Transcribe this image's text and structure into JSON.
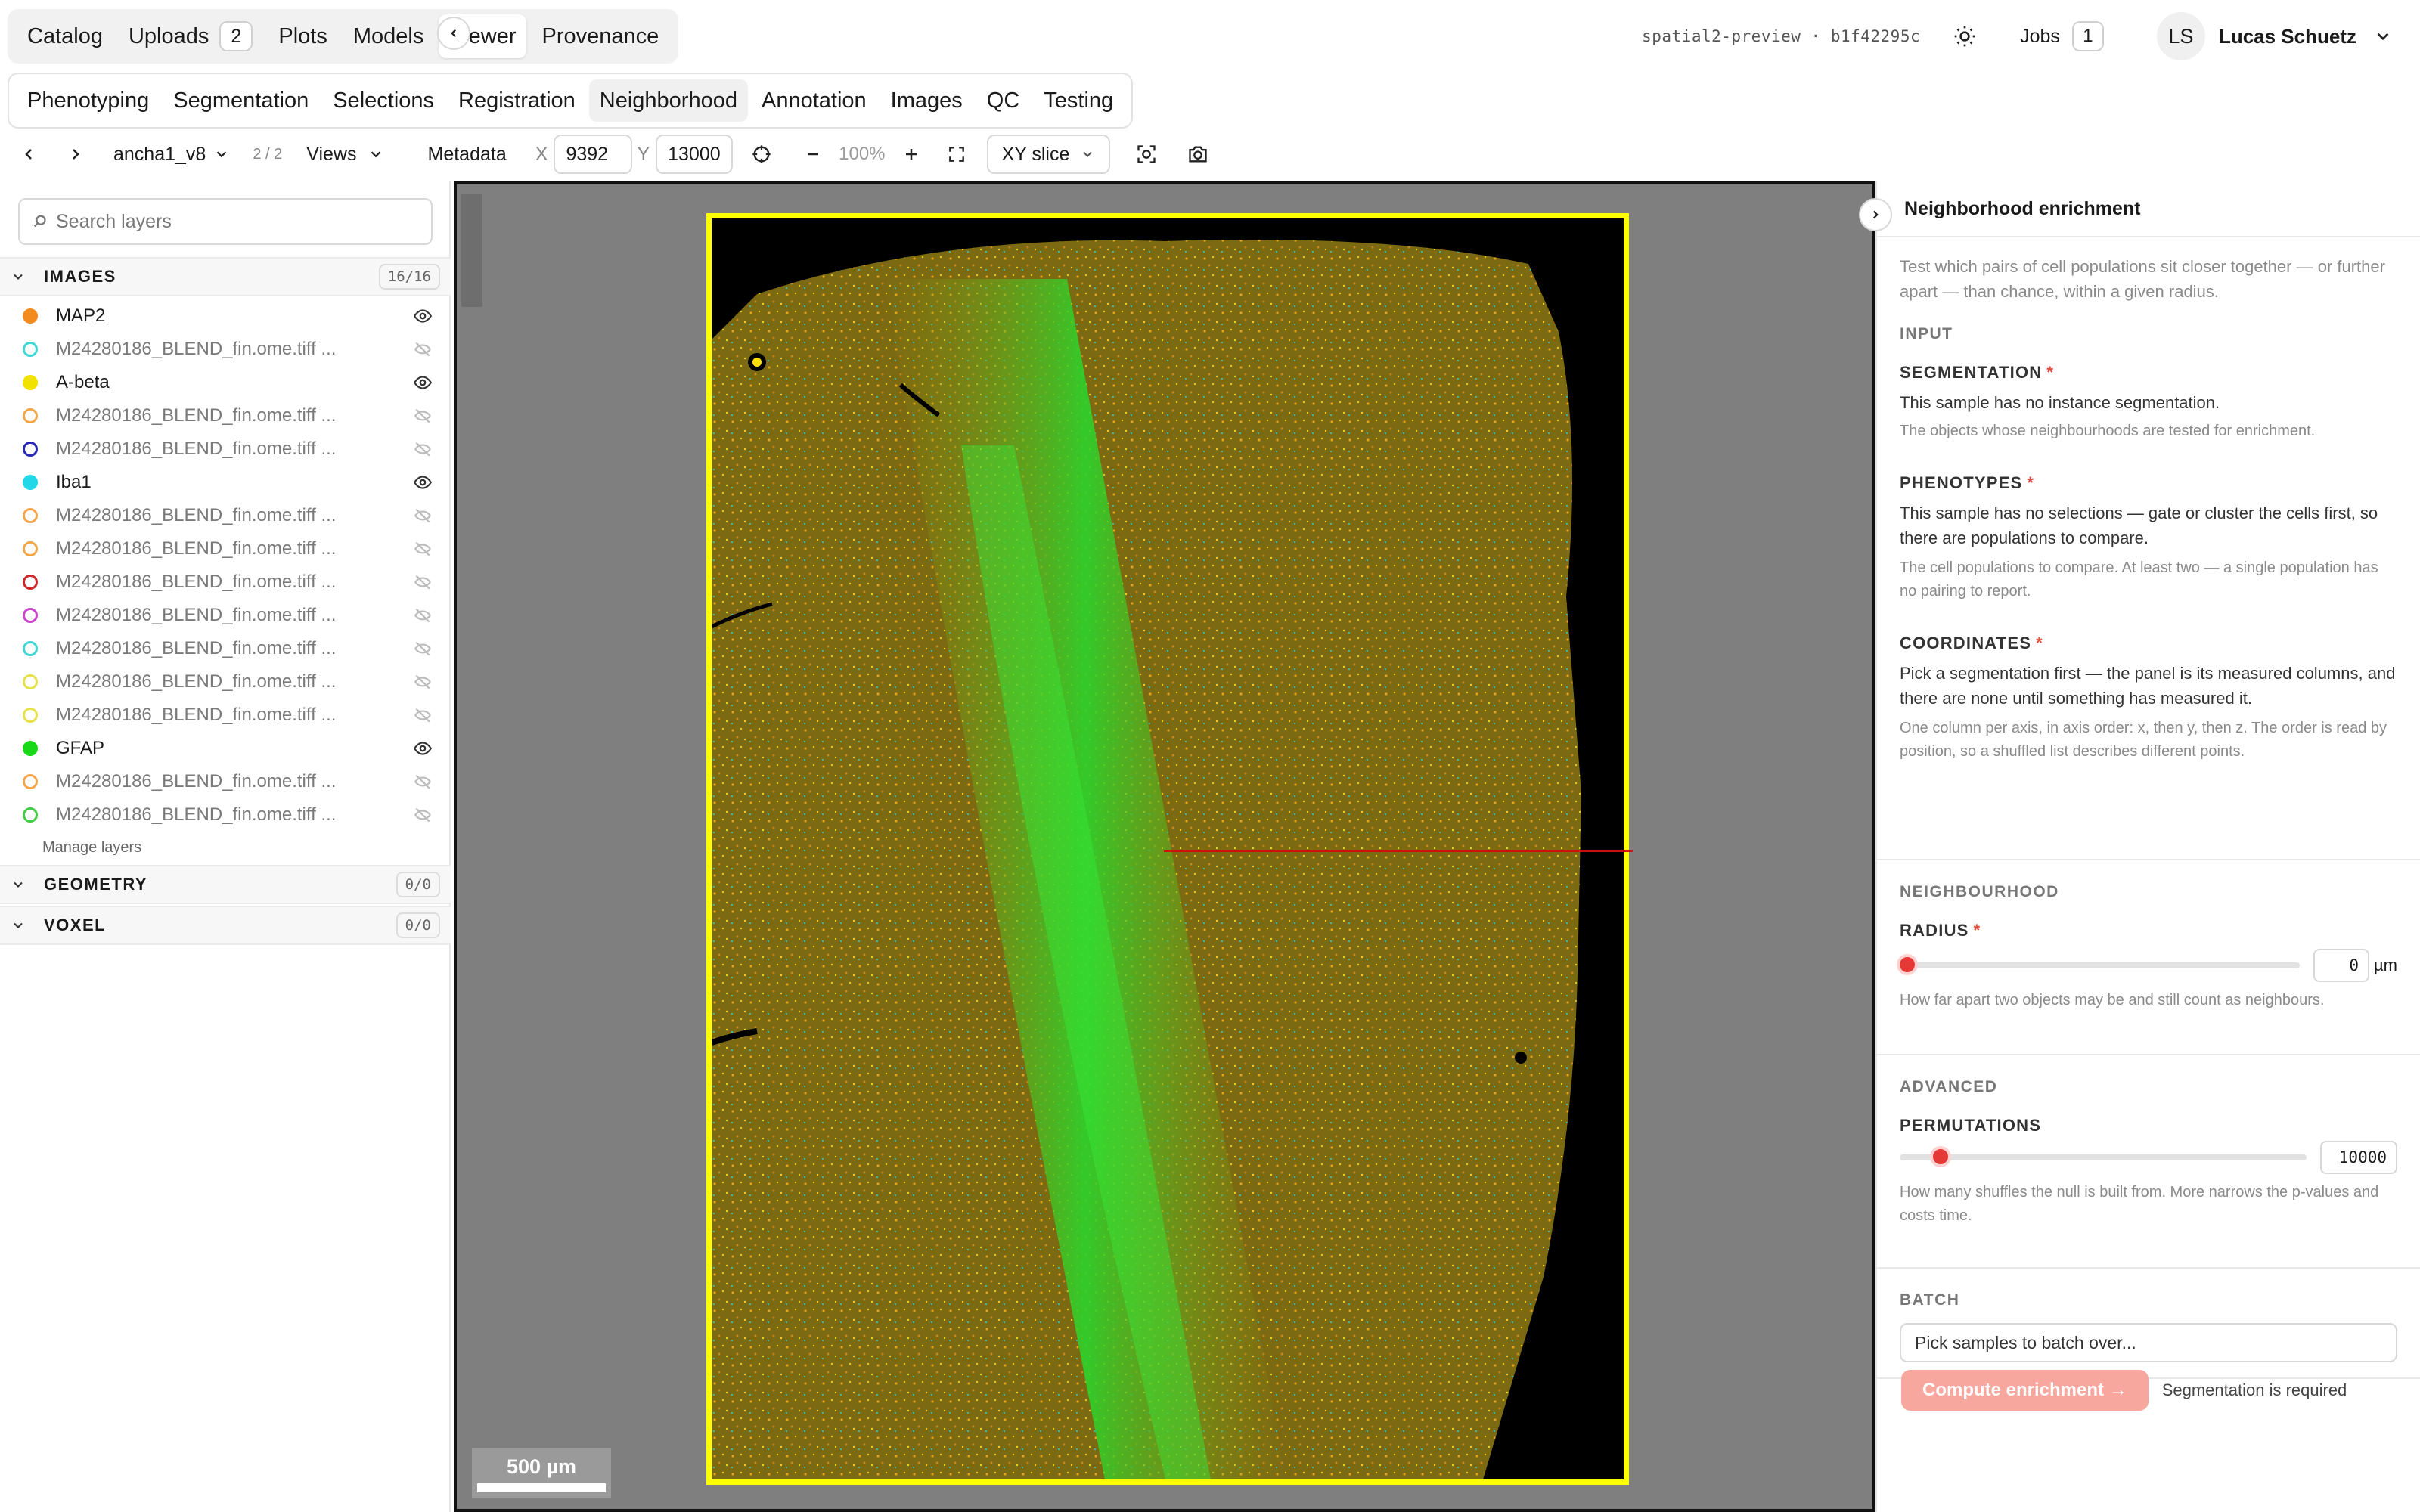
{
  "topnav": {
    "items": [
      {
        "label": "Catalog"
      },
      {
        "label": "Uploads",
        "badge": "2"
      },
      {
        "label": "Plots"
      },
      {
        "label": "Models"
      },
      {
        "label": "Viewer",
        "active": true
      },
      {
        "label": "Provenance"
      }
    ]
  },
  "header": {
    "build_tag": "spatial2-preview · b1f42295c",
    "jobs_label": "Jobs",
    "jobs_count": "1",
    "avatar_initials": "LS",
    "user_name": "Lucas Schuetz"
  },
  "subnav": {
    "items": [
      {
        "label": "Phenotyping"
      },
      {
        "label": "Segmentation"
      },
      {
        "label": "Selections"
      },
      {
        "label": "Registration"
      },
      {
        "label": "Neighborhood",
        "active": true
      },
      {
        "label": "Annotation"
      },
      {
        "label": "Images"
      },
      {
        "label": "QC"
      },
      {
        "label": "Testing"
      }
    ]
  },
  "toolbar": {
    "sample_name": "ancha1_v8",
    "sample_position": "2 / 2",
    "views_label": "Views",
    "metadata_label": "Metadata",
    "x_label": "X",
    "x_value": "9392",
    "y_label": "Y",
    "y_value": "13000",
    "zoom_value": "100%",
    "slice_mode": "XY slice"
  },
  "layers": {
    "search_placeholder": "Search layers",
    "images_header": "IMAGES",
    "images_count": "16/16",
    "items": [
      {
        "name": "MAP2",
        "color": "#f28a1e",
        "filled": true,
        "visible": true
      },
      {
        "name": "M24280186_BLEND_fin.ome.tiff ...",
        "color": "#3fd6d6",
        "filled": false,
        "visible": false
      },
      {
        "name": "A-beta",
        "color": "#f2e200",
        "filled": true,
        "visible": true
      },
      {
        "name": "M24280186_BLEND_fin.ome.tiff ...",
        "color": "#f2a84a",
        "filled": false,
        "visible": false
      },
      {
        "name": "M24280186_BLEND_fin.ome.tiff ...",
        "color": "#2a2ab8",
        "filled": false,
        "visible": false
      },
      {
        "name": "Iba1",
        "color": "#22d8e8",
        "filled": true,
        "visible": true
      },
      {
        "name": "M24280186_BLEND_fin.ome.tiff ...",
        "color": "#f2a84a",
        "filled": false,
        "visible": false
      },
      {
        "name": "M24280186_BLEND_fin.ome.tiff ...",
        "color": "#f2a84a",
        "filled": false,
        "visible": false
      },
      {
        "name": "M24280186_BLEND_fin.ome.tiff ...",
        "color": "#d02828",
        "filled": false,
        "visible": false
      },
      {
        "name": "M24280186_BLEND_fin.ome.tiff ...",
        "color": "#cc44cc",
        "filled": false,
        "visible": false
      },
      {
        "name": "M24280186_BLEND_fin.ome.tiff ...",
        "color": "#3fd6d6",
        "filled": false,
        "visible": false
      },
      {
        "name": "M24280186_BLEND_fin.ome.tiff ...",
        "color": "#e6e04a",
        "filled": false,
        "visible": false
      },
      {
        "name": "M24280186_BLEND_fin.ome.tiff ...",
        "color": "#e6e04a",
        "filled": false,
        "visible": false
      },
      {
        "name": "GFAP",
        "color": "#18d818",
        "filled": true,
        "visible": true
      },
      {
        "name": "M24280186_BLEND_fin.ome.tiff ...",
        "color": "#f2a84a",
        "filled": false,
        "visible": false
      },
      {
        "name": "M24280186_BLEND_fin.ome.tiff ...",
        "color": "#44cc44",
        "filled": false,
        "visible": false
      }
    ],
    "manage_label": "Manage layers",
    "geometry_header": "GEOMETRY",
    "geometry_count": "0/0",
    "voxel_header": "VOXEL",
    "voxel_count": "0/0"
  },
  "viewer": {
    "scalebar_label": "500 µm"
  },
  "panel": {
    "title": "Neighborhood enrichment",
    "intro": "Test which pairs of cell populations sit closer together — or further apart — than chance, within a given radius.",
    "input_group": "INPUT",
    "segmentation_label": "SEGMENTATION",
    "segmentation_body": "This sample has no instance segmentation.",
    "segmentation_help": "The objects whose neighbourhoods are tested for enrichment.",
    "phenotypes_label": "PHENOTYPES",
    "phenotypes_body": "This sample has no selections — gate or cluster the cells first, so there are populations to compare.",
    "phenotypes_help": "The cell populations to compare. At least two — a single population has no pairing to report.",
    "coordinates_label": "COORDINATES",
    "coordinates_body": "Pick a segmentation first — the panel is its measured columns, and there are none until something has measured it.",
    "coordinates_help": "One column per axis, in axis order: x, then y, then z. The order is read by position, so a shuffled list describes different points.",
    "required_mark": "*",
    "neighbourhood_group": "NEIGHBOURHOOD",
    "radius_label": "RADIUS",
    "radius_value": "0",
    "radius_fraction": 0,
    "radius_unit": "µm",
    "radius_help": "How far apart two objects may be and still count as neighbours.",
    "advanced_group": "ADVANCED",
    "permutations_label": "PERMUTATIONS",
    "permutations_value": "10000",
    "permutations_fraction": 0.1,
    "permutations_help": "How many shuffles the null is built from. More narrows the p-values and costs time.",
    "batch_group": "BATCH",
    "batch_placeholder": "Pick samples to batch over...",
    "compute_label": "Compute enrichment →",
    "compute_note": "Segmentation is required"
  },
  "colors": {
    "accent_red": "#e53935",
    "frame_yellow": "#ffff00",
    "compute_disabled": "#f7a79e"
  }
}
